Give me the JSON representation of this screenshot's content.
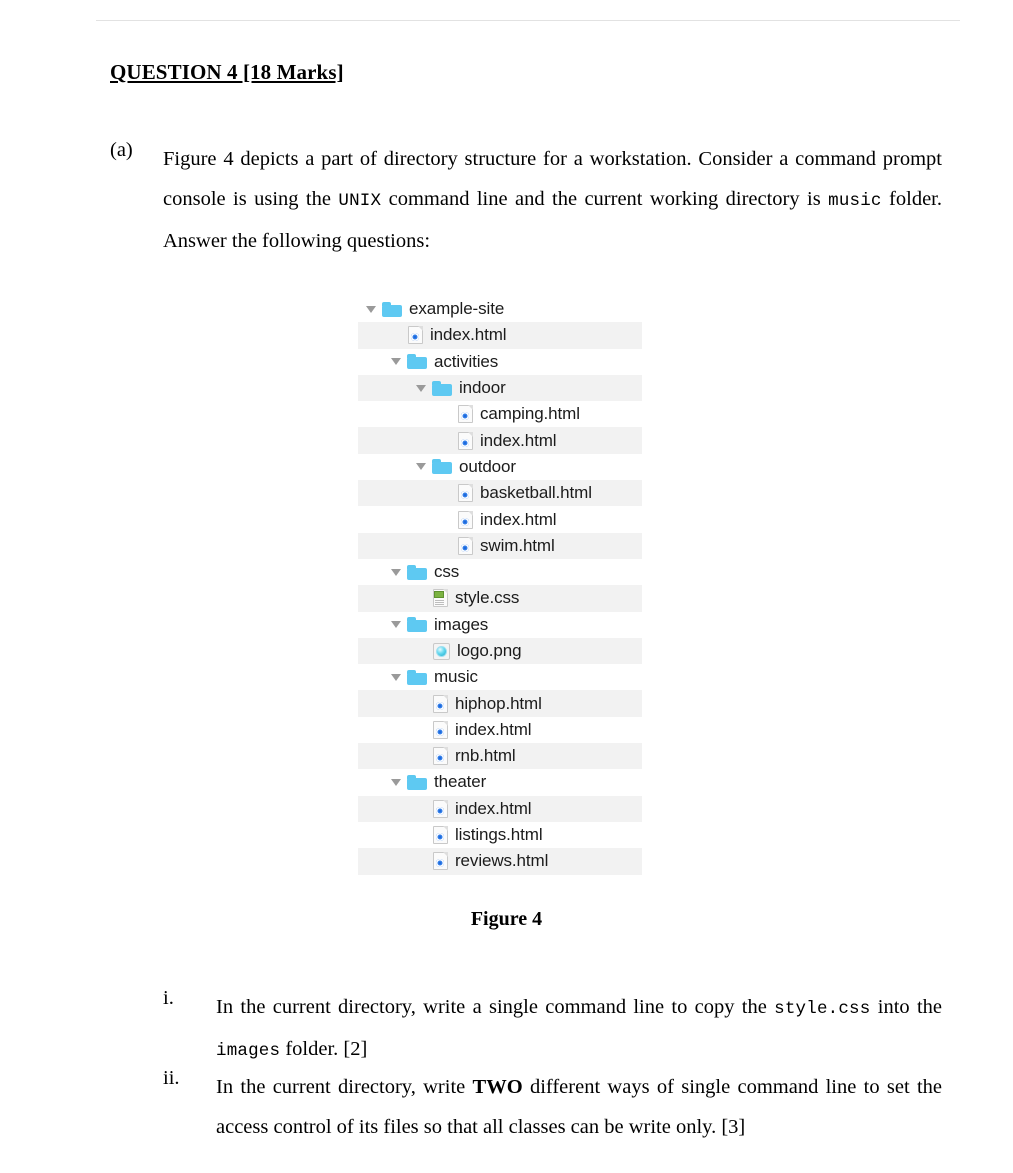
{
  "document": {
    "heading": "QUESTION 4 [18 Marks]",
    "part_a": {
      "label": "(a)",
      "text_1": "Figure 4 depicts a part of directory structure for a workstation. Consider a command prompt console is using the ",
      "mono_1": "UNIX",
      "text_2": " command line  and the current working directory is ",
      "mono_2": "music",
      "text_3": " folder. Answer the following questions:"
    },
    "figure_caption": "Figure 4",
    "questions": [
      {
        "label": "i.",
        "text_1": "In the current directory, write a single command line to copy the ",
        "mono_1": "style.css",
        "text_2": " into the ",
        "mono_2": "images",
        "text_3": " folder. [2]"
      },
      {
        "label": "ii.",
        "text_1": "In the current directory, write ",
        "bold_1": "TWO",
        "text_2": " different ways of single command line to set the access control of its files so that all classes can be write only. [3]"
      }
    ]
  },
  "tree": {
    "rows": [
      {
        "label": "example-site",
        "type": "folder",
        "depth": 0,
        "expanded": true,
        "icon": "folder-icon",
        "stripe": false
      },
      {
        "label": "index.html",
        "type": "file",
        "depth": 1,
        "expanded": false,
        "icon": "html-file-icon",
        "stripe": true
      },
      {
        "label": "activities",
        "type": "folder",
        "depth": 1,
        "expanded": true,
        "icon": "folder-icon",
        "stripe": false
      },
      {
        "label": "indoor",
        "type": "folder",
        "depth": 2,
        "expanded": true,
        "icon": "folder-icon",
        "stripe": true
      },
      {
        "label": "camping.html",
        "type": "file",
        "depth": 3,
        "expanded": false,
        "icon": "html-file-icon",
        "stripe": false
      },
      {
        "label": "index.html",
        "type": "file",
        "depth": 3,
        "expanded": false,
        "icon": "html-file-icon",
        "stripe": true
      },
      {
        "label": "outdoor",
        "type": "folder",
        "depth": 2,
        "expanded": true,
        "icon": "folder-icon",
        "stripe": false
      },
      {
        "label": "basketball.html",
        "type": "file",
        "depth": 3,
        "expanded": false,
        "icon": "html-file-icon",
        "stripe": true
      },
      {
        "label": "index.html",
        "type": "file",
        "depth": 3,
        "expanded": false,
        "icon": "html-file-icon",
        "stripe": false
      },
      {
        "label": "swim.html",
        "type": "file",
        "depth": 3,
        "expanded": false,
        "icon": "html-file-icon",
        "stripe": true
      },
      {
        "label": "css",
        "type": "folder",
        "depth": 1,
        "expanded": true,
        "icon": "folder-icon",
        "stripe": false
      },
      {
        "label": "style.css",
        "type": "file",
        "depth": 2,
        "expanded": false,
        "icon": "css-file-icon",
        "stripe": true
      },
      {
        "label": "images",
        "type": "folder",
        "depth": 1,
        "expanded": true,
        "icon": "folder-icon",
        "stripe": false
      },
      {
        "label": "logo.png",
        "type": "file",
        "depth": 2,
        "expanded": false,
        "icon": "image-file-icon",
        "stripe": true
      },
      {
        "label": "music",
        "type": "folder",
        "depth": 1,
        "expanded": true,
        "icon": "folder-icon",
        "stripe": false
      },
      {
        "label": "hiphop.html",
        "type": "file",
        "depth": 2,
        "expanded": false,
        "icon": "html-file-icon",
        "stripe": true
      },
      {
        "label": "index.html",
        "type": "file",
        "depth": 2,
        "expanded": false,
        "icon": "html-file-icon",
        "stripe": false
      },
      {
        "label": "rnb.html",
        "type": "file",
        "depth": 2,
        "expanded": false,
        "icon": "html-file-icon",
        "stripe": true
      },
      {
        "label": "theater",
        "type": "folder",
        "depth": 1,
        "expanded": true,
        "icon": "folder-icon",
        "stripe": false
      },
      {
        "label": "index.html",
        "type": "file",
        "depth": 2,
        "expanded": false,
        "icon": "html-file-icon",
        "stripe": true
      },
      {
        "label": "listings.html",
        "type": "file",
        "depth": 2,
        "expanded": false,
        "icon": "html-file-icon",
        "stripe": false
      },
      {
        "label": "reviews.html",
        "type": "file",
        "depth": 2,
        "expanded": false,
        "icon": "html-file-icon",
        "stripe": true
      }
    ]
  },
  "colors": {
    "folder": "#5ec9f2",
    "stripe": "#f2f2f2",
    "rule": "#e2e2e2",
    "twisty": "#9a9a9a",
    "html_dot": "#2f7ce8",
    "css_green": "#7cb342"
  }
}
